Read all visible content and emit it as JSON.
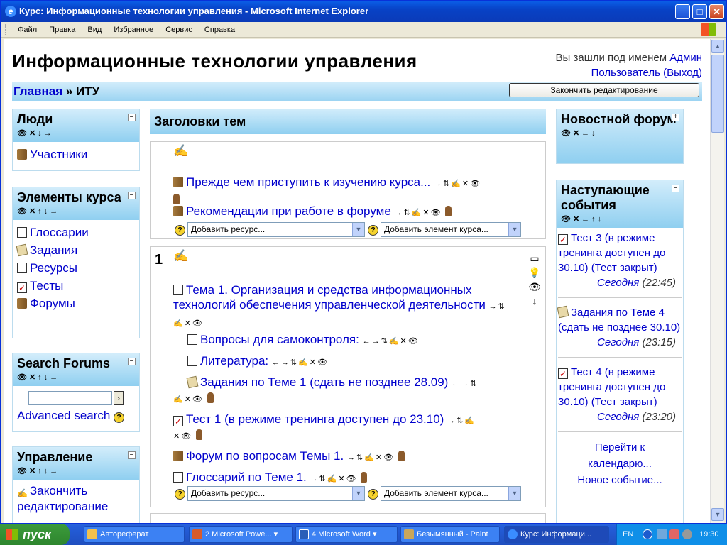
{
  "window": {
    "title": "Курс: Информационные технологии управления - Microsoft Internet Explorer"
  },
  "menu": [
    "Файл",
    "Правка",
    "Вид",
    "Избранное",
    "Сервис",
    "Справка"
  ],
  "site": {
    "title": "Информационные технологии управления",
    "login_prefix": "Вы зашли под именем",
    "user_first": "Админ",
    "user_last": "Пользователь",
    "logout": "(Выход)"
  },
  "nav": {
    "home": "Главная",
    "sep": "»",
    "course": "ИТУ",
    "edit_button": "Закончить редактирование"
  },
  "left": {
    "people": {
      "title": "Люди",
      "controls": "👁✕↓→",
      "items": [
        "Участники"
      ]
    },
    "elements": {
      "title": "Элементы курса",
      "controls": "👁✕↑↓→",
      "items": [
        "Глоссарии",
        "Задания",
        "Ресурсы",
        "Тесты",
        "Форумы"
      ]
    },
    "search": {
      "title": "Search Forums",
      "controls": "👁✕↑↓→",
      "go": "›",
      "advanced": "Advanced search"
    },
    "admin": {
      "title": "Управление",
      "controls": "👁✕↑↓→",
      "items": [
        "Закончить редактирование"
      ]
    }
  },
  "center": {
    "header": "Заголовки тем",
    "section0": {
      "items": [
        {
          "label": "Прежде чем приступить к изучению курса...",
          "tools": "→⇅✍✕👁"
        },
        {
          "label": "Рекомендации при работе в форуме",
          "tools": "→⇅✍✕👁"
        }
      ]
    },
    "section1": {
      "number": "1",
      "topic": {
        "label": "Тема 1. Организация и средства информационных технологий обеспечения управленческой деятельности",
        "tools": "→⇅✍✕👁"
      },
      "items": [
        {
          "label": "Вопросы для самоконтроля:",
          "tools": "←→⇅✍✕👁"
        },
        {
          "label": "Литература:",
          "tools": "←→⇅✍✕👁"
        },
        {
          "label": "Задания по Теме 1 (сдать не позднее 28.09)",
          "tools": "←→⇅",
          "tools2": "✍✕👁"
        },
        {
          "label": "Тест 1 (в режиме тренинга доступен до 23.10)",
          "tools": "→⇅✍",
          "tools2": "✕👁"
        },
        {
          "label": "Форум по вопросам Темы 1.",
          "tools": "→⇅✍✕👁"
        },
        {
          "label": "Глоссарий по Теме 1.",
          "tools": "→⇅✍✕👁"
        }
      ]
    },
    "add_resource": "Добавить ресурс...",
    "add_activity": "Добавить элемент курса..."
  },
  "right": {
    "news": {
      "title": "Новостной форум",
      "controls": "👁✕←↓"
    },
    "events": {
      "title": "Наступающие события",
      "controls": "👁✕←↑↓",
      "items": [
        {
          "text": "Тест 3 (в режиме тренинга доступен до 30.10) (Тест закрыт)",
          "day": "Сегодня",
          "time": "(22:45)"
        },
        {
          "text": "Задания по Теме 4 (сдать не позднее 30.10)",
          "day": "Сегодня",
          "time": "(23:15)"
        },
        {
          "text": "Тест 4 (в режиме тренинга доступен до 30.10) (Тест закрыт)",
          "day": "Сегодня",
          "time": "(23:20)"
        }
      ],
      "goto_calendar": "Перейти к календарю...",
      "new_event": "Новое событие..."
    }
  },
  "taskbar": {
    "start": "пуск",
    "tasks": [
      "Автореферат",
      "2 Microsoft Powe...",
      "4 Microsoft Word",
      "Безымянный - Paint",
      "Курс: Информаци..."
    ],
    "lang": "EN",
    "clock": "19:30"
  }
}
